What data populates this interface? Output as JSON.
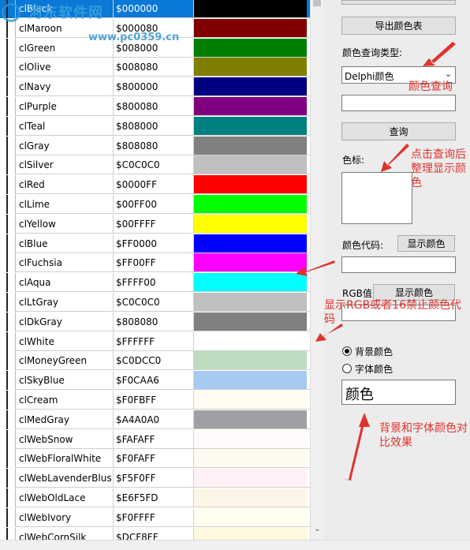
{
  "colors": [
    {
      "name": "clBlack",
      "code": "$000000",
      "swatch": "#000000"
    },
    {
      "name": "clMaroon",
      "code": "$000080",
      "swatch": "#800000"
    },
    {
      "name": "clGreen",
      "code": "$008000",
      "swatch": "#008000"
    },
    {
      "name": "clOlive",
      "code": "$008080",
      "swatch": "#808000"
    },
    {
      "name": "clNavy",
      "code": "$800000",
      "swatch": "#000080"
    },
    {
      "name": "clPurple",
      "code": "$800080",
      "swatch": "#800080"
    },
    {
      "name": "clTeal",
      "code": "$808000",
      "swatch": "#008080"
    },
    {
      "name": "clGray",
      "code": "$808080",
      "swatch": "#808080"
    },
    {
      "name": "clSilver",
      "code": "$C0C0C0",
      "swatch": "#C0C0C0"
    },
    {
      "name": "clRed",
      "code": "$0000FF",
      "swatch": "#FF0000"
    },
    {
      "name": "clLime",
      "code": "$00FF00",
      "swatch": "#00FF00"
    },
    {
      "name": "clYellow",
      "code": "$00FFFF",
      "swatch": "#FFFF00"
    },
    {
      "name": "clBlue",
      "code": "$FF0000",
      "swatch": "#0000FF"
    },
    {
      "name": "clFuchsia",
      "code": "$FF00FF",
      "swatch": "#FF00FF"
    },
    {
      "name": "clAqua",
      "code": "$FFFF00",
      "swatch": "#00FFFF"
    },
    {
      "name": "clLtGray",
      "code": "$C0C0C0",
      "swatch": "#C0C0C0"
    },
    {
      "name": "clDkGray",
      "code": "$808080",
      "swatch": "#808080"
    },
    {
      "name": "clWhite",
      "code": "$FFFFFF",
      "swatch": "#FFFFFF"
    },
    {
      "name": "clMoneyGreen",
      "code": "$C0DCC0",
      "swatch": "#C0DCC0"
    },
    {
      "name": "clSkyBlue",
      "code": "$F0CAA6",
      "swatch": "#A6CAF0"
    },
    {
      "name": "clCream",
      "code": "$F0FBFF",
      "swatch": "#FFFBF0"
    },
    {
      "name": "clMedGray",
      "code": "$A4A0A0",
      "swatch": "#A0A0A4"
    },
    {
      "name": "clWebSnow",
      "code": "$FAFAFF",
      "swatch": "#FFFAFA"
    },
    {
      "name": "clWebFloralWhite",
      "code": "$F0FAFF",
      "swatch": "#FFFAF0"
    },
    {
      "name": "clWebLavenderBlush",
      "code": "$F5F0FF",
      "swatch": "#FFF0F5"
    },
    {
      "name": "clWebOldLace",
      "code": "$E6F5FD",
      "swatch": "#FDF5E6"
    },
    {
      "name": "clWebIvory",
      "code": "$F0FFFF",
      "swatch": "#FFFFF0"
    },
    {
      "name": "clWebCornSilk",
      "code": "$DCF8FF",
      "swatch": "#FFF8DC"
    }
  ],
  "selected_row": 0,
  "watermark": {
    "text": "河东软件网",
    "url": "www.pc0359.cn"
  },
  "panel": {
    "export_button": "导出颜色表",
    "query_type_label": "颜色查询类型:",
    "query_type_value": "Delphi颜色",
    "query_input": "",
    "query_button": "查询",
    "swatch_label": "色标:",
    "color_code_label": "颜色代码:",
    "show_color_button_1": "显示颜色",
    "color_code_input": "",
    "rgb_label": "RGB值",
    "show_color_button_2": "显示颜色",
    "rgb_input": "",
    "radio_background": "背景颜色",
    "radio_font": "字体颜色",
    "demo_text": "颜色"
  },
  "annotations": {
    "query": "颜色查询",
    "after_query": "点击查询后整理显示颜色",
    "show_code": "显示RGB或者16禁止颜色代码",
    "contrast": "背景和字体颜色对比效果"
  },
  "accent_color": "#0a78d7",
  "annotation_color": "#e0322d"
}
